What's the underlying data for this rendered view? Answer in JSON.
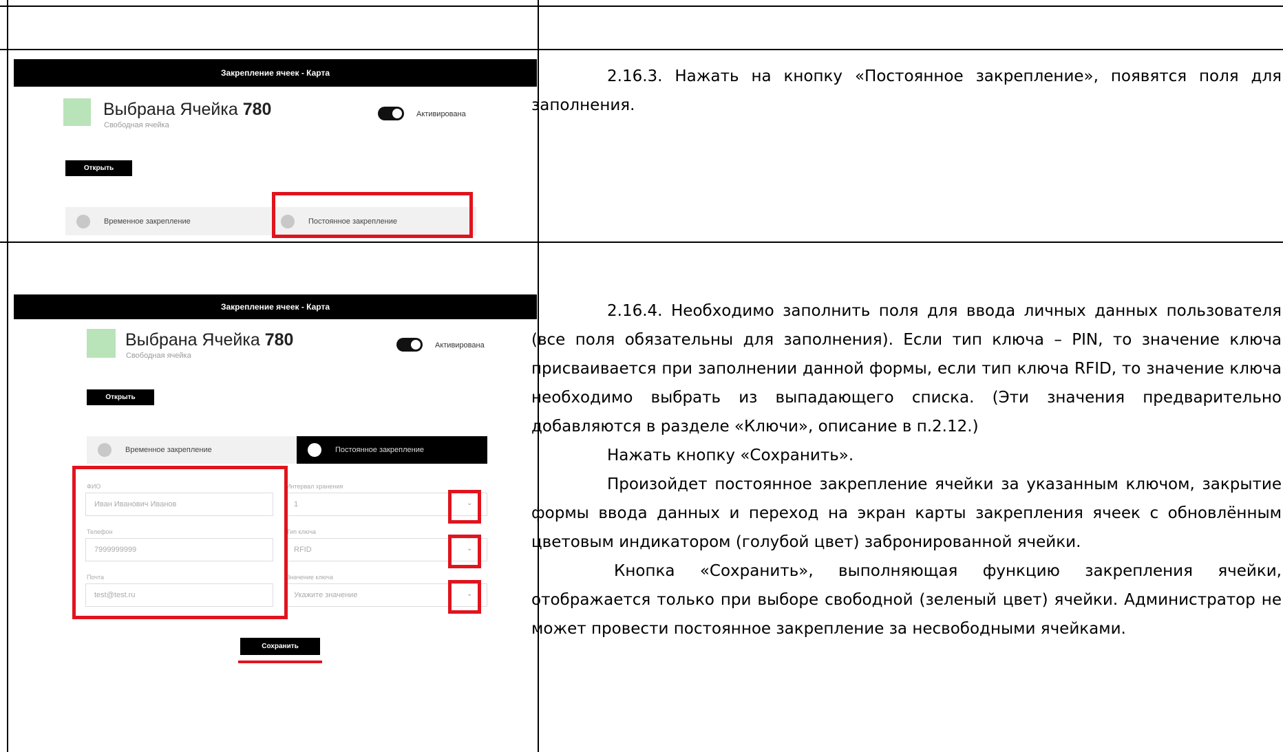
{
  "screens": {
    "top": {
      "header": "Закрепление ячеек - Карта",
      "cell_title_prefix": "Выбрана Ячейка ",
      "cell_number": "780",
      "cell_status": "Свободная ячейка",
      "toggle_label": "Активирована",
      "open_button": "Открыть",
      "temp_option": "Временное закрепление",
      "perm_option": "Постоянное закрепление"
    },
    "bottom": {
      "header": "Закрепление ячеек - Карта",
      "cell_title_prefix": "Выбрана Ячейка ",
      "cell_number": "780",
      "cell_status": "Свободная ячейка",
      "toggle_label": "Активирована",
      "open_button": "Открыть",
      "temp_option": "Временное закрепление",
      "perm_option": "Постоянное закрепление",
      "fields": {
        "fio_label": "ФИО",
        "fio_value": "Иван Иванович Иванов",
        "phone_label": "Телефон",
        "phone_value": "7999999999",
        "email_label": "Почта",
        "email_value": "test@test.ru",
        "interval_label": "Интервал хранения",
        "interval_value": "1",
        "key_type_label": "Тип ключа",
        "key_type_value": "RFID",
        "key_value_label": "Значение ключа",
        "key_value_placeholder": "Укажите значение"
      },
      "save_button": "Сохранить"
    }
  },
  "text": {
    "step3": "2.16.3. Нажать на кнопку «Постоянное закрепление», появятся поля для заполнения.",
    "step4": "2.16.4. Необходимо заполнить поля для ввода личных данных пользователя (все поля обязательны для заполнения). Если тип ключа – PIN, то значение ключа присваивается при заполнении данной формы, если тип ключа RFID, то значение ключа необходимо выбрать из выпадающего списка. (Эти значения предварительно добавляются в разделе «Ключи», описание в п.2.12.)",
    "step4_save": "Нажать кнопку «Сохранить».",
    "step4_result": "Произойдет постоянное закрепление ячейки за указанным ключом, закрытие формы ввода данных и переход на экран карты закрепления ячеек с обновлённым цветовым индикатором (голубой цвет) забронированной ячейки.",
    "step4_note": "Кнопка «Сохранить», выполняющая функцию закрепления ячейки, отображается только при выборе свободной (зеленый цвет) ячейки. Администратор не может провести постоянное закрепление за несвободными ячейками."
  },
  "colors": {
    "highlight": "#e0141e",
    "free_cell": "#b9e3b8"
  }
}
